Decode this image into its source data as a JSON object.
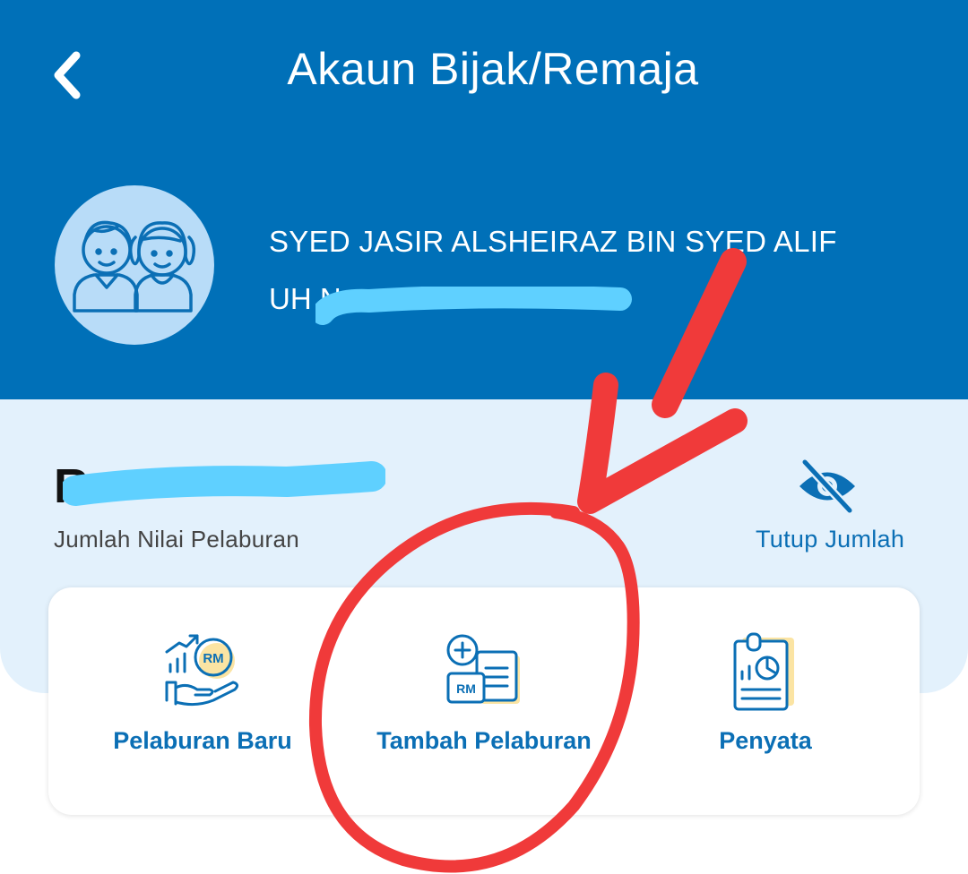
{
  "header": {
    "title": "Akaun Bijak/Remaja",
    "back_icon": "chevron-left-icon"
  },
  "profile": {
    "avatar_icon": "children-icon",
    "name": "SYED JASIR ALSHEIRAZ BIN SYED ALIF",
    "account_label": "UH No."
  },
  "summary": {
    "amount_visible": "R",
    "amount_label": "Jumlah Nilai Pelaburan",
    "hide_label": "Tutup Jumlah",
    "hide_icon": "eye-slash-icon"
  },
  "actions": [
    {
      "label": "Pelaburan Baru",
      "icon": "investment-growth-icon"
    },
    {
      "label": "Tambah Pelaburan",
      "icon": "add-investment-icon"
    },
    {
      "label": "Penyata",
      "icon": "statement-icon"
    }
  ],
  "colors": {
    "primary": "#0070b8",
    "light_bg": "#e3f1fc",
    "accent_text": "#0b6fb5",
    "icon_highlight": "#f7c948",
    "redaction": "#5fd0ff",
    "annotation": "#f03a3a"
  }
}
